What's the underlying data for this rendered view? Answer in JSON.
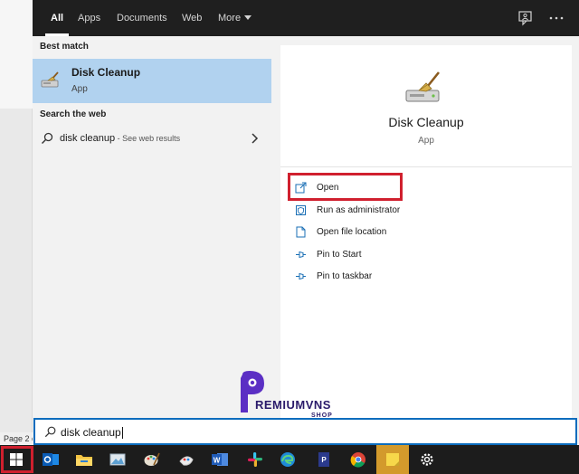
{
  "tabs": [
    {
      "label": "All",
      "active": true
    },
    {
      "label": "Apps",
      "active": false
    },
    {
      "label": "Documents",
      "active": false
    },
    {
      "label": "Web",
      "active": false
    },
    {
      "label": "More",
      "active": false
    }
  ],
  "left": {
    "best_match_header": "Best match",
    "best_match": {
      "title": "Disk Cleanup",
      "subtitle": "App"
    },
    "web_header": "Search the web",
    "web_result": {
      "query": "disk cleanup",
      "suffix": " - See web results"
    }
  },
  "detail": {
    "title": "Disk Cleanup",
    "subtitle": "App",
    "actions": [
      {
        "label": "Open",
        "icon": "open-icon",
        "highlighted": true
      },
      {
        "label": "Run as administrator",
        "icon": "shield-icon"
      },
      {
        "label": "Open file location",
        "icon": "file-location-icon"
      },
      {
        "label": "Pin to Start",
        "icon": "pin-icon"
      },
      {
        "label": "Pin to taskbar",
        "icon": "pin-icon"
      }
    ]
  },
  "search": {
    "value": "disk cleanup"
  },
  "background": {
    "status_text": "Page 2 c"
  },
  "watermark": {
    "text_main": "PREMIUMVNS",
    "text_sub": "SHOP"
  },
  "taskbar": {
    "items": [
      "windows-start-icon",
      "outlook-icon",
      "file-explorer-icon",
      "photo-viewer-icon",
      "paint-icon",
      "paint-icon",
      "word-icon",
      "slack-icon",
      "edge-icon",
      "pdf-reader-icon",
      "chrome-icon",
      "sticky-notes-icon",
      "settings-icon"
    ]
  },
  "colors": {
    "accent_blue": "#0b6cbd",
    "selection_blue": "#b1d2ef",
    "highlight_red": "#d0202e",
    "topbar": "#1f1f1f",
    "taskbar": "#1c1c1c"
  }
}
